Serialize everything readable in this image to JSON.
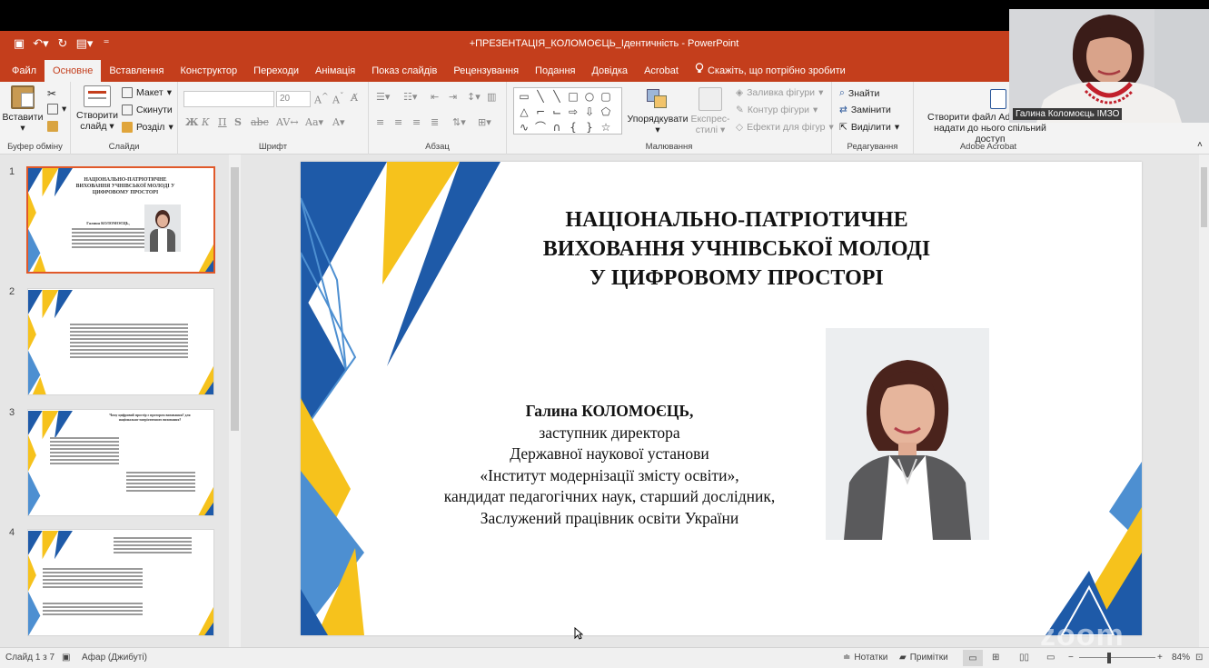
{
  "window": {
    "title": "+ПРЕЗЕНТАЦІЯ_КОЛОМОЄЦЬ_Ідентичність  -  PowerPoint"
  },
  "tabs": [
    "Файл",
    "Основне",
    "Вставлення",
    "Конструктор",
    "Переходи",
    "Анімація",
    "Показ слайдів",
    "Рецензування",
    "Подання",
    "Довідка",
    "Acrobat"
  ],
  "tell_me": "Скажіть, що потрібно зробити",
  "ribbon": {
    "clipboard": {
      "paste": "Вставити",
      "label": "Буфер обміну"
    },
    "slides": {
      "new_slide": "Створити слайд",
      "layout": "Макет",
      "reset": "Скинути",
      "section": "Розділ",
      "label": "Слайди"
    },
    "font": {
      "size": "20",
      "label": "Шрифт"
    },
    "paragraph": {
      "label": "Абзац"
    },
    "drawing": {
      "arrange": "Упорядкувати",
      "quick_styles": "Експрес-стилі",
      "fill": "Заливка фігури",
      "outline": "Контур фігури",
      "effects": "Ефекти для фігур",
      "label": "Малювання"
    },
    "editing": {
      "find": "Знайти",
      "replace": "Замінити",
      "select": "Виділити",
      "label": "Редагування"
    },
    "acrobat": {
      "share": "Створити файл Adobe PDF і надати до нього спільний доступ",
      "label": "Adobe Acrobat"
    }
  },
  "thumbnails": [
    {
      "number": "1",
      "title": "НАЦІОНАЛЬНО-ПАТРІОТИЧНЕ ВИХОВАННЯ УЧНІВСЬКОЇ МОЛОДІ У ЦИФРОВОМУ ПРОСТОРІ",
      "name": "Галина КОЛОМОЄЦЬ,"
    },
    {
      "number": "2"
    },
    {
      "number": "3",
      "heading": "Чому цифровий простір є протором виховання? для національно-патріотичного виховання?"
    },
    {
      "number": "4"
    }
  ],
  "slide": {
    "title_lines": [
      "НАЦІОНАЛЬНО-ПАТРІОТИЧНЕ",
      "ВИХОВАННЯ УЧНІВСЬКОЇ МОЛОДІ",
      "У ЦИФРОВОМУ ПРОСТОРІ"
    ],
    "name": "Галина КОЛОМОЄЦЬ,",
    "info_lines": [
      "заступник директора",
      "Державної наукової установи",
      "«Інститут модернізації змісту освіти»,",
      "кандидат педагогічних наук, старший дослідник,",
      "Заслужений працівник освіти України"
    ],
    "colors": {
      "blue": "#1e5aa8",
      "yellow": "#f6c21c",
      "light_blue": "#4d8fd1"
    }
  },
  "status": {
    "slide_counter": "Слайд 1 з 7",
    "language": "Афар (Джибуті)",
    "notes": "Нотатки",
    "comments": "Примітки",
    "zoom": "84%"
  },
  "webcam": {
    "label": "Галина Коломоєць ІМЗО"
  },
  "watermark": "zoom",
  "theme": {
    "accent": "#c43e1c"
  }
}
